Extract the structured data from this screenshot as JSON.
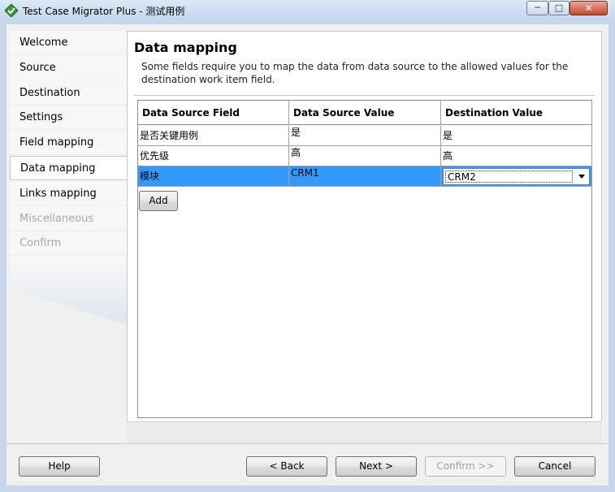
{
  "window": {
    "title": "Test Case Migrator Plus - 测试用例",
    "controls": {
      "minimize": "─",
      "maximize": "□",
      "close": "✕"
    }
  },
  "sidebar": {
    "items": [
      {
        "label": "Welcome",
        "state": "normal"
      },
      {
        "label": "Source",
        "state": "normal"
      },
      {
        "label": "Destination",
        "state": "normal"
      },
      {
        "label": "Settings",
        "state": "normal"
      },
      {
        "label": "Field mapping",
        "state": "normal"
      },
      {
        "label": "Data mapping",
        "state": "active"
      },
      {
        "label": "Links mapping",
        "state": "normal"
      },
      {
        "label": "Miscellaneous",
        "state": "disabled"
      },
      {
        "label": "Confirm",
        "state": "disabled"
      }
    ]
  },
  "main": {
    "title": "Data mapping",
    "description": "Some fields require you to map the data from data source to the allowed values for the destination work item field.",
    "grid": {
      "headers": [
        "Data Source Field",
        "Data Source Value",
        "Destination Value"
      ],
      "rows": [
        {
          "field": "是否关键用例",
          "source_value": "是",
          "destination_value": "是",
          "selected": false
        },
        {
          "field": "优先级",
          "source_value": "高",
          "destination_value": "高",
          "selected": false
        },
        {
          "field": "模块",
          "source_value": "CRM1",
          "destination_value": "CRM2",
          "selected": true
        }
      ]
    },
    "add_label": "Add"
  },
  "footer": {
    "help": "Help",
    "back": "< Back",
    "next": "Next >",
    "confirm": "Confirm >>",
    "cancel": "Cancel"
  },
  "colors": {
    "selection": "#3399ff",
    "titlebar": "#c4d6ec",
    "close_button": "#c7452e"
  }
}
